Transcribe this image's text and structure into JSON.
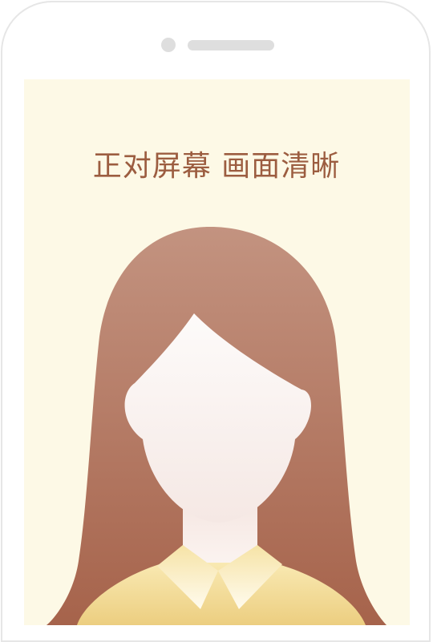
{
  "instruction_text": "正对屏幕 画面清晰",
  "colors": {
    "screen_background": "#fdf9e6",
    "instruction_text": "#9c5d40",
    "hair_top": "#c2907b",
    "hair_bottom": "#a8654c",
    "skin": "#faf4f2",
    "shirt": "#f1d88f",
    "device_frame": "#e6e6e6"
  },
  "icons": [
    "camera-icon",
    "speaker-icon",
    "female-avatar-silhouette"
  ]
}
